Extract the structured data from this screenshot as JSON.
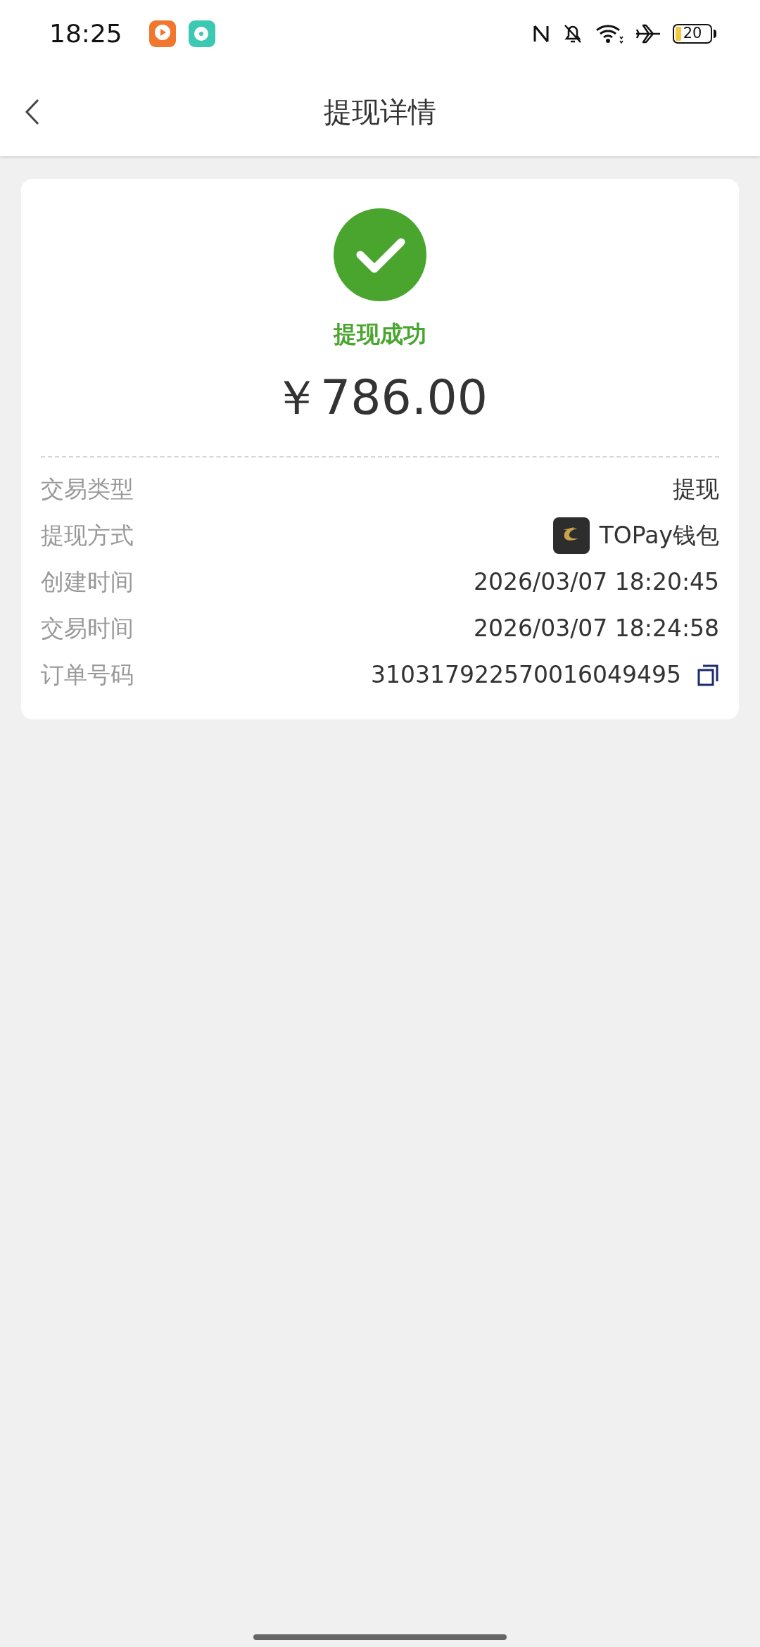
{
  "status_bar": {
    "time": "18:25",
    "battery": "20"
  },
  "header": {
    "title": "提现详情"
  },
  "result": {
    "status": "提现成功",
    "amount": "￥786.00"
  },
  "details": [
    {
      "kind": "text",
      "label": "交易类型",
      "value": "提现"
    },
    {
      "kind": "wallet",
      "label": "提现方式",
      "value": "TOPay钱包"
    },
    {
      "kind": "text",
      "label": "创建时间",
      "value": "2026/03/07 18:20:45"
    },
    {
      "kind": "text",
      "label": "交易时间",
      "value": "2026/03/07 18:24:58"
    },
    {
      "kind": "copy",
      "label": "订单号码",
      "value": "310317922570016049495"
    }
  ]
}
